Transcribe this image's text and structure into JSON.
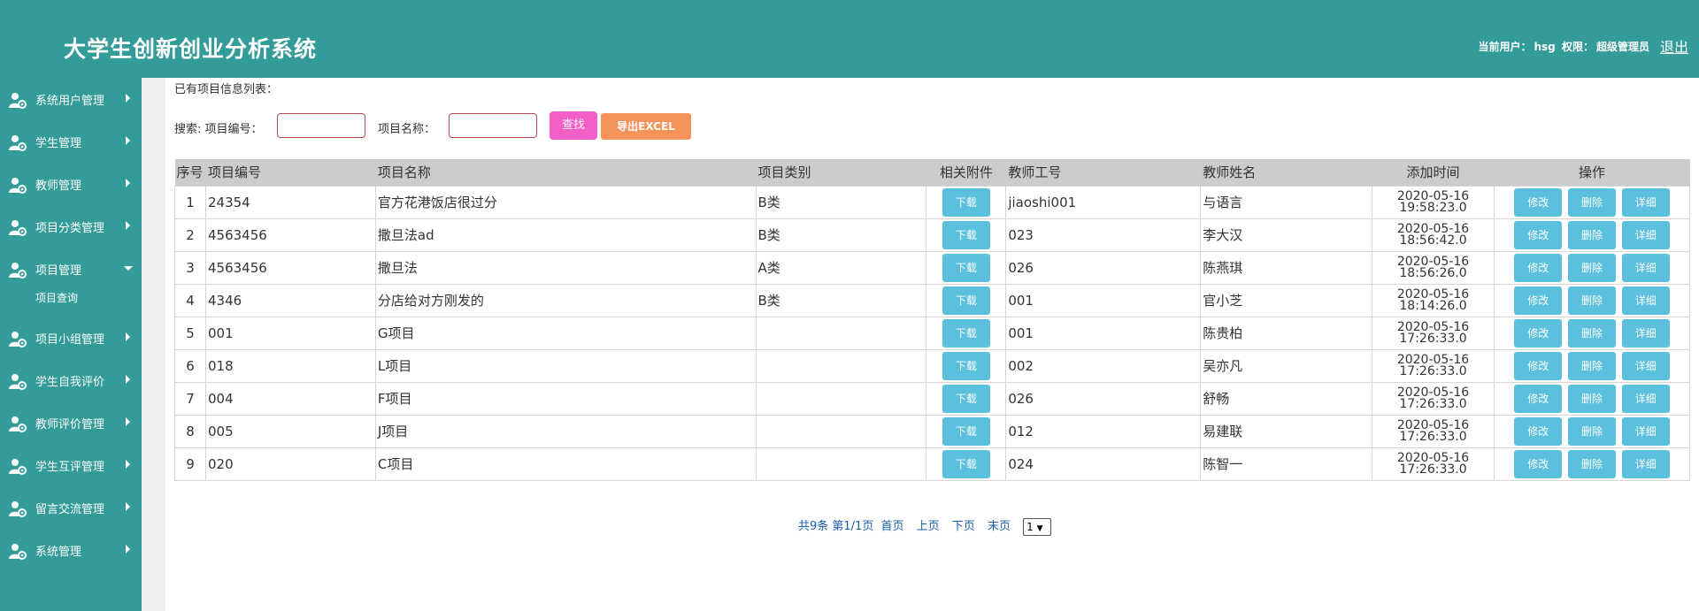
{
  "header": {
    "title": "大学生创新创业分析系统",
    "user_label": "当前用户：",
    "user_name": "hsg",
    "perm_label": "权限：",
    "perm_value": "超级管理员",
    "logout": "退出"
  },
  "sidebar": {
    "items": [
      {
        "label": "系统用户管理"
      },
      {
        "label": "学生管理"
      },
      {
        "label": "教师管理"
      },
      {
        "label": "项目分类管理"
      },
      {
        "label": "项目管理",
        "sub": "项目查询"
      },
      {
        "label": "项目小组管理"
      },
      {
        "label": "学生自我评价"
      },
      {
        "label": "教师评价管理"
      },
      {
        "label": "学生互评管理"
      },
      {
        "label": "留言交流管理"
      },
      {
        "label": "系统管理"
      }
    ]
  },
  "content": {
    "list_title": "已有项目信息列表：",
    "search_label1": "搜索: 项目编号：",
    "search_label2": "项目名称：",
    "search_value1": "",
    "search_value2": "",
    "find_button": "查找",
    "excel_button": "导出EXCEL"
  },
  "table": {
    "headers": [
      "序号",
      "项目编号",
      "项目名称",
      "项目类别",
      "相关附件",
      "教师工号",
      "教师姓名",
      "添加时间",
      "操作"
    ],
    "download_label": "下载",
    "edit_label": "修改",
    "delete_label": "删除",
    "detail_label": "详细",
    "rows": [
      {
        "idx": "1",
        "code": "24354",
        "name": "官方花港饭店很过分",
        "cat": "B类",
        "tno": "jiaoshi001",
        "tname": "与语言",
        "date": "2020-05-16",
        "time": "19:58:23.0"
      },
      {
        "idx": "2",
        "code": "4563456",
        "name": "撒旦法ad",
        "cat": "B类",
        "tno": "023",
        "tname": "李大汉",
        "date": "2020-05-16",
        "time": "18:56:42.0"
      },
      {
        "idx": "3",
        "code": "4563456",
        "name": "撒旦法",
        "cat": "A类",
        "tno": "026",
        "tname": "陈燕琪",
        "date": "2020-05-16",
        "time": "18:56:26.0"
      },
      {
        "idx": "4",
        "code": "4346",
        "name": "分店给对方刚发的",
        "cat": "B类",
        "tno": "001",
        "tname": "官小芝",
        "date": "2020-05-16",
        "time": "18:14:26.0"
      },
      {
        "idx": "5",
        "code": "001",
        "name": "G项目",
        "cat": "",
        "tno": "001",
        "tname": "陈贵柏",
        "date": "2020-05-16",
        "time": "17:26:33.0"
      },
      {
        "idx": "6",
        "code": "018",
        "name": "L项目",
        "cat": "",
        "tno": "002",
        "tname": "吴亦凡",
        "date": "2020-05-16",
        "time": "17:26:33.0"
      },
      {
        "idx": "7",
        "code": "004",
        "name": "F项目",
        "cat": "",
        "tno": "026",
        "tname": "舒畅",
        "date": "2020-05-16",
        "time": "17:26:33.0"
      },
      {
        "idx": "8",
        "code": "005",
        "name": "J项目",
        "cat": "",
        "tno": "012",
        "tname": "易建联",
        "date": "2020-05-16",
        "time": "17:26:33.0"
      },
      {
        "idx": "9",
        "code": "020",
        "name": "C项目",
        "cat": "",
        "tno": "024",
        "tname": "陈智一",
        "date": "2020-05-16",
        "time": "17:26:33.0"
      }
    ]
  },
  "pager": {
    "info": "共9条  第1/1页",
    "first": "首页",
    "prev": "上页",
    "next": "下页",
    "last": "末页",
    "page_select": "1"
  },
  "colors": {
    "theme": "#339b98",
    "find_button": "#f25fc6",
    "excel_button": "#f5935a",
    "action_button": "#5bc0de"
  }
}
